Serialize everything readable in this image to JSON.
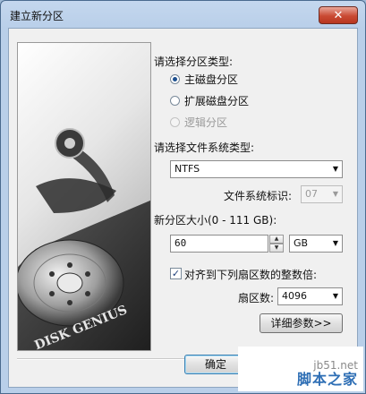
{
  "window": {
    "title": "建立新分区",
    "close_glyph": "✕"
  },
  "banner": {
    "text": "DISK GENIUS"
  },
  "partition_type": {
    "label": "请选择分区类型:",
    "options": [
      {
        "label": "主磁盘分区",
        "checked": true,
        "disabled": false
      },
      {
        "label": "扩展磁盘分区",
        "checked": false,
        "disabled": false
      },
      {
        "label": "逻辑分区",
        "checked": false,
        "disabled": true
      }
    ]
  },
  "filesystem": {
    "label": "请选择文件系统类型:",
    "value": "NTFS"
  },
  "fs_id": {
    "label": "文件系统标识:",
    "value": "07"
  },
  "size": {
    "label": "新分区大小(0 - 111 GB):",
    "value": "60",
    "unit": "GB"
  },
  "align": {
    "label": "对齐到下列扇区数的整数倍:",
    "checked": true
  },
  "sectors": {
    "label": "扇区数:",
    "value": "4096"
  },
  "details_button": "详细参数>>",
  "ok_button": "确定",
  "watermark": {
    "line1": "jb51.net",
    "line2": "脚本之家"
  }
}
